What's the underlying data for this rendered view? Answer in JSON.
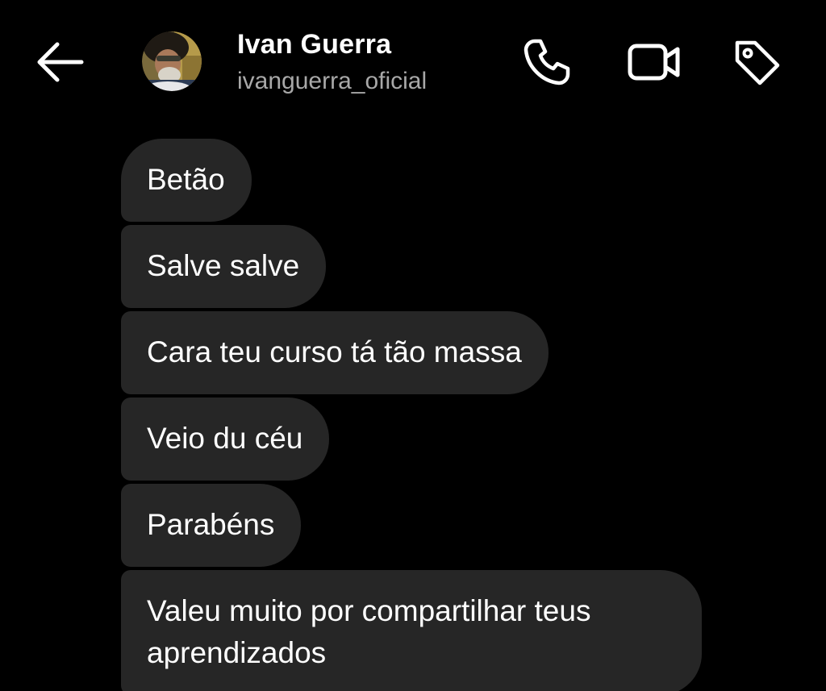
{
  "header": {
    "contact_name": "Ivan Guerra",
    "contact_handle": "ivanguerra_oficial",
    "icons": {
      "back": "arrow-left-icon",
      "call": "phone-icon",
      "video": "video-camera-icon",
      "tag": "tag-icon"
    }
  },
  "messages": [
    {
      "text": "Betão"
    },
    {
      "text": "Salve salve"
    },
    {
      "text": "Cara teu curso tá tão massa"
    },
    {
      "text": "Veio du céu"
    },
    {
      "text": "Parabéns"
    },
    {
      "text": "Valeu muito por compartilhar teus aprendizados"
    }
  ],
  "colors": {
    "background": "#000000",
    "bubble": "#262626",
    "text": "#ffffff",
    "secondary_text": "#a8a8a8"
  }
}
